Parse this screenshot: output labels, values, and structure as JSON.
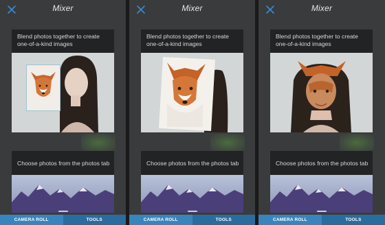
{
  "panels": [
    {
      "title": "Mixer",
      "card1_text": "Blend photos together to create one-of-a-kind images",
      "card2_text": "Choose photos from the photos tab",
      "tabs": [
        "CAMERA ROLL",
        "TOOLS"
      ]
    },
    {
      "title": "Mixer",
      "card1_text": "Blend photos together to create one-of-a-kind images",
      "card2_text": "Choose photos from the photos tab",
      "tabs": [
        "CAMERA ROLL",
        "TOOLS"
      ]
    },
    {
      "title": "Mixer",
      "card1_text": "Blend photos together to create one-of-a-kind images",
      "card2_text": "Choose photos from the photos tab",
      "tabs": [
        "CAMERA ROLL",
        "TOOLS"
      ]
    }
  ],
  "icons": {
    "close": "close-icon"
  },
  "colors": {
    "accent": "#2b6c9e",
    "accent_active": "#3a84bd",
    "background": "#3a3b3d",
    "card": "#222325"
  }
}
